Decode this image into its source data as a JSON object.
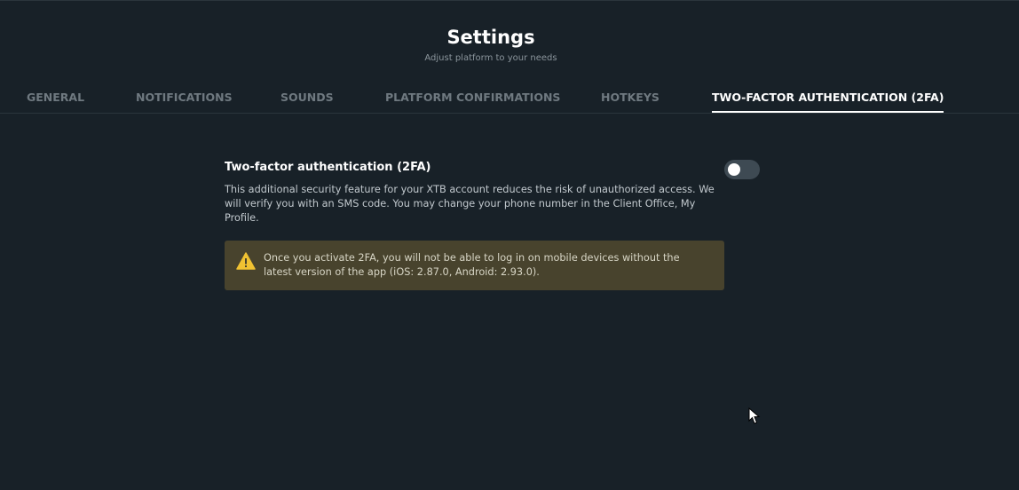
{
  "header": {
    "title": "Settings",
    "subtitle": "Adjust platform to your needs"
  },
  "tabs": [
    {
      "label": "GENERAL",
      "active": false
    },
    {
      "label": "NOTIFICATIONS",
      "active": false
    },
    {
      "label": "SOUNDS",
      "active": false
    },
    {
      "label": "PLATFORM CONFIRMATIONS",
      "active": false
    },
    {
      "label": "HOTKEYS",
      "active": false
    },
    {
      "label": "TWO-FACTOR AUTHENTICATION (2FA)",
      "active": true
    }
  ],
  "two_factor": {
    "title": "Two-factor authentication (2FA)",
    "enabled": false,
    "description": "This additional security feature for your XTB account reduces the risk of unauthorized access. We will verify you with an SMS code. You may change your phone number in the Client Office, My Profile.",
    "warning": {
      "icon": "warning-triangle-icon",
      "text": "Once you activate 2FA, you will not be able to log in on mobile devices without the latest version of the app (iOS: 2.87.0, Android: 2.93.0)."
    }
  },
  "colors": {
    "background": "#182128",
    "warning_background": "#48432d",
    "warning_icon": "#f0c232",
    "toggle_off": "#3e4a53"
  }
}
